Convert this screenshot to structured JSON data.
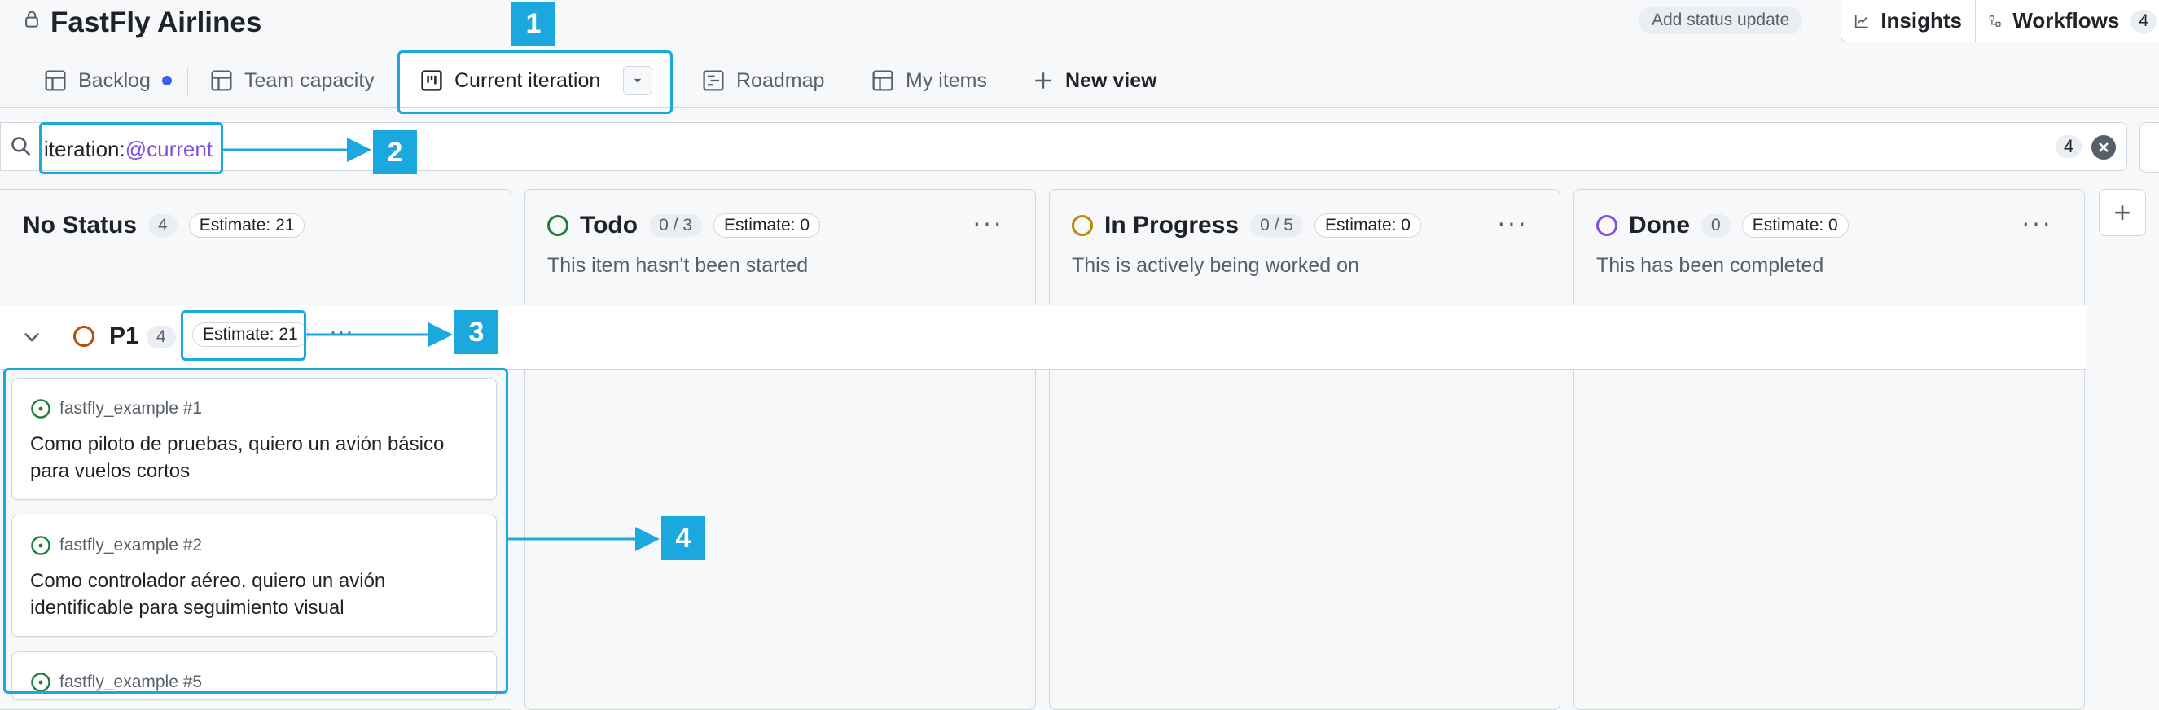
{
  "header": {
    "title": "FastFly Airlines",
    "status_button": "Add status update",
    "insights_label": "Insights",
    "workflows_label": "Workflows",
    "workflows_count": "4"
  },
  "tabs": [
    {
      "label": "Backlog",
      "icon": "table-icon",
      "has_dot": true
    },
    {
      "label": "Team capacity",
      "icon": "table-icon"
    },
    {
      "label": "Current iteration",
      "icon": "board-icon",
      "active": true
    },
    {
      "label": "Roadmap",
      "icon": "roadmap-icon"
    },
    {
      "label": "My items",
      "icon": "table-icon"
    },
    {
      "label": "New view",
      "icon": "plus-icon"
    }
  ],
  "filter": {
    "prefix": "iteration:",
    "value": "@current",
    "count": "4"
  },
  "columns": [
    {
      "name": "No Status",
      "count": "4",
      "estimate": "Estimate: 21",
      "description": ""
    },
    {
      "name": "Todo",
      "count": "0 / 3",
      "estimate": "Estimate: 0",
      "description": "This item hasn't been started"
    },
    {
      "name": "In Progress",
      "count": "0 / 5",
      "estimate": "Estimate: 0",
      "description": "This is actively being worked on"
    },
    {
      "name": "Done",
      "count": "0",
      "estimate": "Estimate: 0",
      "description": "This has been completed"
    }
  ],
  "group": {
    "name": "P1",
    "count": "4",
    "estimate": "Estimate: 21"
  },
  "cards": [
    {
      "ref": "fastfly_example #1",
      "title": "Como piloto de pruebas, quiero un avión básico para vuelos cortos"
    },
    {
      "ref": "fastfly_example #2",
      "title": "Como controlador aéreo, quiero un avión identificable para seguimiento visual"
    },
    {
      "ref": "fastfly_example #5",
      "title": ""
    }
  ],
  "annotations": [
    "1",
    "2",
    "3",
    "4"
  ],
  "colors": {
    "accent": "#1aa8de",
    "todo": "#1a7f37",
    "in_progress": "#bf8700",
    "done": "#8250df",
    "p1": "#bc4c00",
    "open_issue": "#1a7f37"
  }
}
